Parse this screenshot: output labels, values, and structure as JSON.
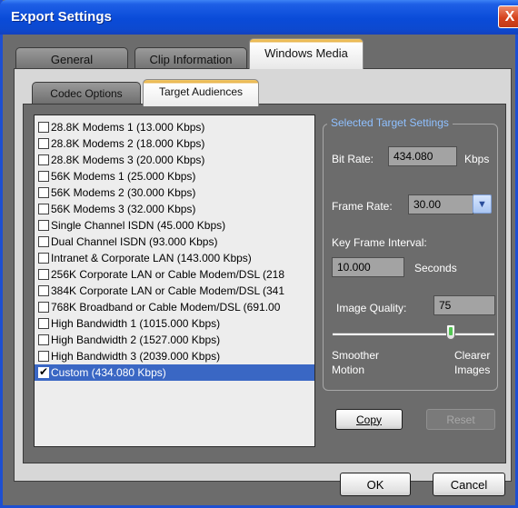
{
  "window": {
    "title": "Export Settings",
    "close_glyph": "X"
  },
  "tabs": [
    "General",
    "Clip Information",
    "Windows Media"
  ],
  "subtabs": [
    "Codec Options",
    "Target Audiences"
  ],
  "audiences": [
    {
      "label": "28.8K Modems 1 (13.000 Kbps)",
      "checked": false
    },
    {
      "label": "28.8K Modems 2 (18.000 Kbps)",
      "checked": false
    },
    {
      "label": "28.8K Modems 3 (20.000 Kbps)",
      "checked": false
    },
    {
      "label": "56K Modems 1 (25.000 Kbps)",
      "checked": false
    },
    {
      "label": "56K Modems 2 (30.000 Kbps)",
      "checked": false
    },
    {
      "label": "56K Modems 3 (32.000 Kbps)",
      "checked": false
    },
    {
      "label": "Single Channel ISDN (45.000 Kbps)",
      "checked": false
    },
    {
      "label": "Dual Channel ISDN (93.000 Kbps)",
      "checked": false
    },
    {
      "label": "Intranet & Corporate LAN (143.000 Kbps)",
      "checked": false
    },
    {
      "label": "256K Corporate LAN or Cable Modem/DSL (218",
      "checked": false
    },
    {
      "label": "384K Corporate LAN or Cable Modem/DSL (341",
      "checked": false
    },
    {
      "label": "768K Broadband or Cable Modem/DSL (691.00",
      "checked": false
    },
    {
      "label": "High Bandwidth 1 (1015.000 Kbps)",
      "checked": false
    },
    {
      "label": "High Bandwidth 2 (1527.000 Kbps)",
      "checked": false
    },
    {
      "label": "High Bandwidth 3 (2039.000 Kbps)",
      "checked": false
    },
    {
      "label": "Custom (434.080 Kbps)",
      "checked": true,
      "selected": true
    }
  ],
  "settings": {
    "group_title": "Selected Target Settings",
    "bit_rate_label": "Bit Rate:",
    "bit_rate_value": "434.080",
    "bit_rate_unit": "Kbps",
    "frame_rate_label": "Frame Rate:",
    "frame_rate_value": "30.00",
    "key_frame_label": "Key Frame Interval:",
    "key_frame_value": "10.000",
    "key_frame_unit": "Seconds",
    "image_quality_label": "Image Quality:",
    "image_quality_value": "75",
    "slider_left_1": "Smoother",
    "slider_left_2": "Motion",
    "slider_right_1": "Clearer",
    "slider_right_2": "Images",
    "copy_label": "Copy",
    "reset_label": "Reset"
  },
  "footer": {
    "ok_label": "OK",
    "cancel_label": "Cancel"
  },
  "colors": {
    "titlebar": "#0a4bd8",
    "selection": "#3a67c4",
    "group_title": "#8fc0ff"
  }
}
